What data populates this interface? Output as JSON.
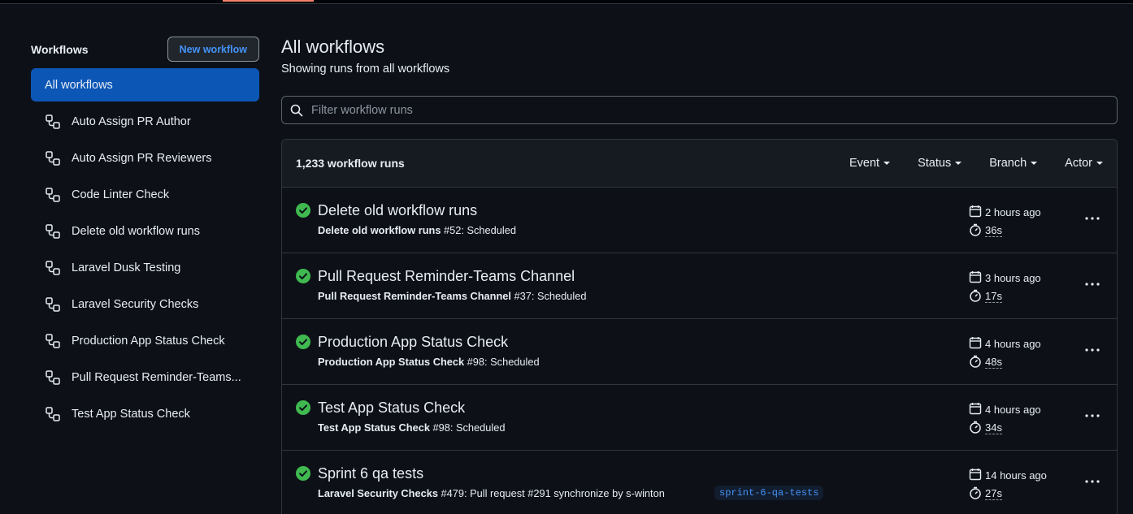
{
  "sidebar": {
    "title": "Workflows",
    "new_workflow_label": "New workflow",
    "items": [
      {
        "label": "All workflows",
        "active": true
      },
      {
        "label": "Auto Assign PR Author"
      },
      {
        "label": "Auto Assign PR Reviewers"
      },
      {
        "label": "Code Linter Check"
      },
      {
        "label": "Delete old workflow runs"
      },
      {
        "label": "Laravel Dusk Testing"
      },
      {
        "label": "Laravel Security Checks"
      },
      {
        "label": "Production App Status Check"
      },
      {
        "label": "Pull Request Reminder-Teams..."
      },
      {
        "label": "Test App Status Check"
      }
    ]
  },
  "main": {
    "title": "All workflows",
    "subtitle": "Showing runs from all workflows",
    "filter_placeholder": "Filter workflow runs",
    "runs_count": "1,233 workflow runs",
    "filters": [
      "Event",
      "Status",
      "Branch",
      "Actor"
    ],
    "runs": [
      {
        "title": "Delete old workflow runs",
        "workflow": "Delete old workflow runs",
        "detail": " #52: Scheduled",
        "time": "2 hours ago",
        "duration": "36s",
        "branch": ""
      },
      {
        "title": "Pull Request Reminder-Teams Channel",
        "workflow": "Pull Request Reminder-Teams Channel",
        "detail": " #37: Scheduled",
        "time": "3 hours ago",
        "duration": "17s",
        "branch": ""
      },
      {
        "title": "Production App Status Check",
        "workflow": "Production App Status Check",
        "detail": " #98: Scheduled",
        "time": "4 hours ago",
        "duration": "48s",
        "branch": ""
      },
      {
        "title": "Test App Status Check",
        "workflow": "Test App Status Check",
        "detail": " #98: Scheduled",
        "time": "4 hours ago",
        "duration": "34s",
        "branch": ""
      },
      {
        "title": "Sprint 6 qa tests",
        "workflow": "Laravel Security Checks",
        "detail": " #479: Pull request #291 synchronize by s-winton",
        "time": "14 hours ago",
        "duration": "27s",
        "branch": "sprint-6-qa-tests"
      }
    ]
  },
  "colors": {
    "accent": "#0c56b6",
    "success": "#3fb950",
    "link": "#4493f8"
  }
}
